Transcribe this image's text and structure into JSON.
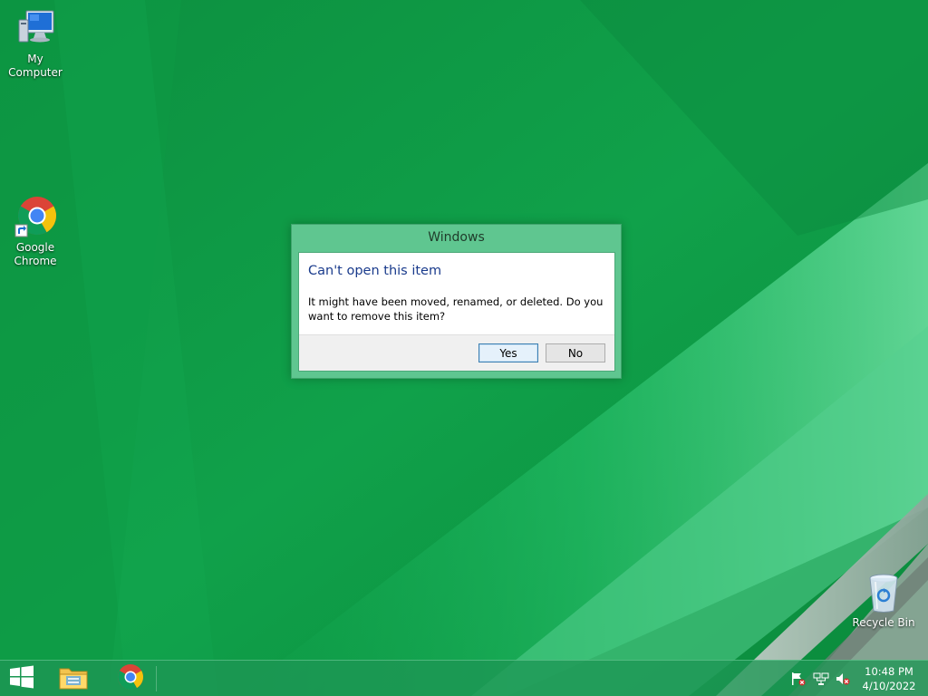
{
  "desktop": {
    "icons": [
      {
        "label": "My Computer"
      },
      {
        "label": "Google\nChrome"
      },
      {
        "label": "Recycle Bin"
      }
    ]
  },
  "dialog": {
    "title": "Windows",
    "heading": "Can't open this item",
    "message": "It might have been moved, renamed, or deleted. Do you want to remove this item?",
    "yes_label": "Yes",
    "no_label": "No"
  },
  "taskbar": {
    "pinned": [
      {
        "name": "start-button",
        "icon": "windows-logo-icon"
      },
      {
        "name": "file-explorer",
        "icon": "folder-icon"
      },
      {
        "name": "google-chrome",
        "icon": "chrome-icon"
      }
    ],
    "tray_icons": [
      "action-center-flag-icon",
      "network-icon",
      "volume-muted-icon"
    ],
    "clock": {
      "time": "10:48 PM",
      "date": "4/10/2022"
    }
  },
  "colors": {
    "wallpaper": "#0f9a45",
    "dialog_frame": "#5fc690",
    "heading_text": "#1a3b8c",
    "taskbar": "#1e9655"
  }
}
